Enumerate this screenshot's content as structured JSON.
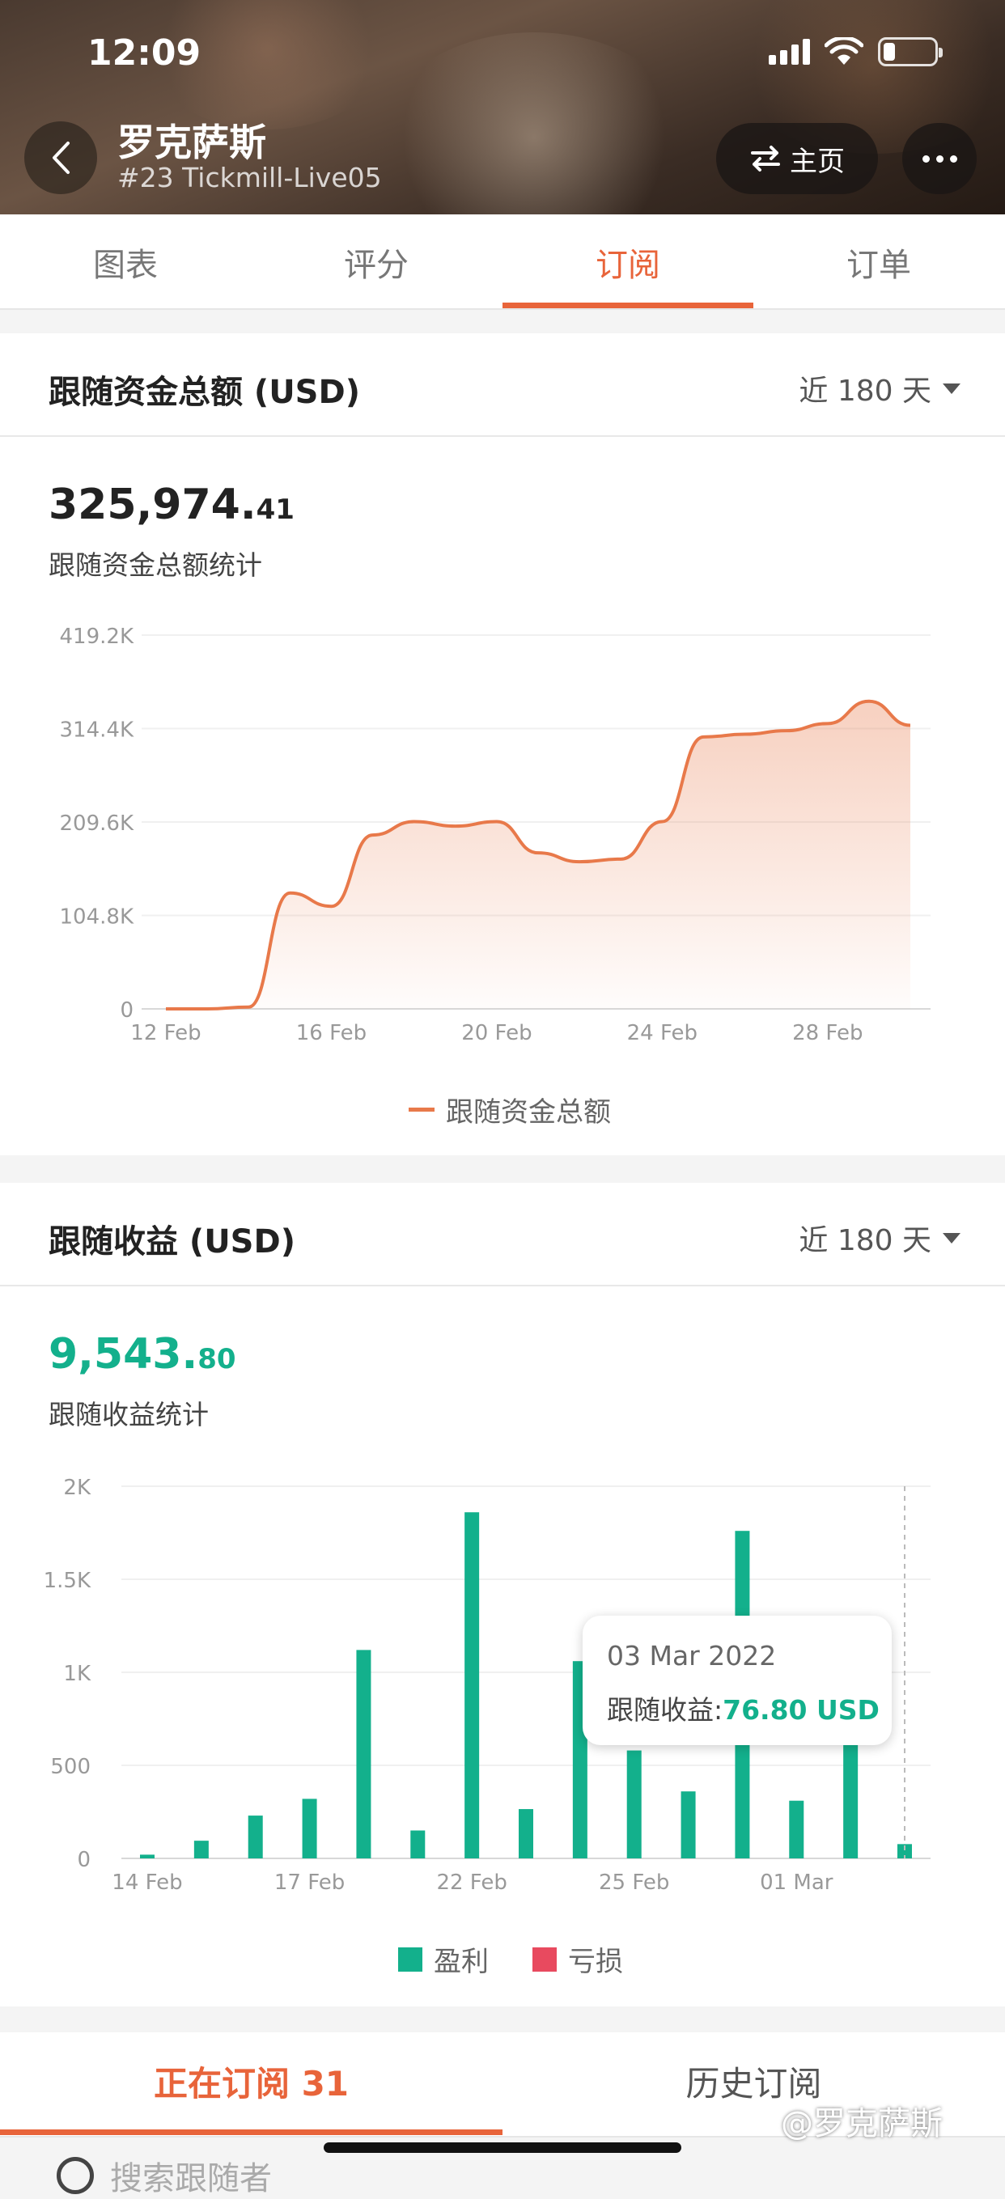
{
  "status": {
    "time": "12:09"
  },
  "header": {
    "title": "罗克萨斯",
    "subtitle": "#23 Tickmill-Live05",
    "home_label": "主页"
  },
  "tabs": [
    {
      "label": "图表",
      "active": false
    },
    {
      "label": "评分",
      "active": false
    },
    {
      "label": "订阅",
      "active": true
    },
    {
      "label": "订单",
      "active": false
    }
  ],
  "funds_card": {
    "title": "跟随资金总额 (USD)",
    "range": "近 180 天",
    "total_int": "325,974.",
    "total_dec": "41",
    "total_label": "跟随资金总额统计",
    "legend": "跟随资金总额"
  },
  "profit_card": {
    "title": "跟随收益 (USD)",
    "range": "近 180 天",
    "total_int": "9,543.",
    "total_dec": "80",
    "total_label": "跟随收益统计",
    "legend_profit": "盈利",
    "legend_loss": "亏损",
    "tooltip_date": "03 Mar 2022",
    "tooltip_label": "跟随收益:",
    "tooltip_value": "76.80 USD"
  },
  "colors": {
    "accent": "#e8643a",
    "profit": "#13b08c",
    "loss": "#e84a5f",
    "line": "#e8794a"
  },
  "chart_data": [
    {
      "type": "area",
      "series": [
        {
          "name": "跟随资金总额",
          "x": [
            "12 Feb",
            "13 Feb",
            "14 Feb",
            "15 Feb",
            "16 Feb",
            "17 Feb",
            "18 Feb",
            "19 Feb",
            "20 Feb",
            "21 Feb",
            "22 Feb",
            "23 Feb",
            "24 Feb",
            "25 Feb",
            "26 Feb",
            "27 Feb",
            "28 Feb",
            "01 Mar",
            "02 Mar"
          ],
          "values": [
            0,
            0,
            2000,
            130000,
            115000,
            195000,
            210000,
            205000,
            210000,
            175000,
            165000,
            168000,
            210000,
            305000,
            308000,
            312000,
            320000,
            345000,
            318000
          ]
        }
      ],
      "x_ticks": [
        "12 Feb",
        "16 Feb",
        "20 Feb",
        "24 Feb",
        "28 Feb"
      ],
      "y_ticks": [
        "0",
        "104.8K",
        "209.6K",
        "314.4K",
        "419.2K"
      ],
      "ylim": [
        0,
        419200
      ],
      "legend": "bottom-center"
    },
    {
      "type": "bar",
      "categories": [
        "14 Feb",
        "15 Feb",
        "16 Feb",
        "17 Feb",
        "18 Feb",
        "19 Feb",
        "21 Feb",
        "22 Feb",
        "23 Feb",
        "24 Feb",
        "25 Feb",
        "26 Feb",
        "27 Feb",
        "28 Feb",
        "01 Mar",
        "02 Mar",
        "03 Mar"
      ],
      "series": [
        {
          "name": "盈利",
          "values": [
            20,
            95,
            230,
            320,
            1120,
            150,
            1860,
            265,
            1060,
            580,
            360,
            1760,
            310,
            620,
            76.8
          ]
        }
      ],
      "x_ticks": [
        "14 Feb",
        "17 Feb",
        "22 Feb",
        "25 Feb",
        "01 Mar"
      ],
      "y_ticks": [
        "0",
        "500",
        "1K",
        "1.5K",
        "2K"
      ],
      "ylim": [
        0,
        2000
      ],
      "legend": "bottom-center"
    }
  ],
  "bottom_tabs": [
    {
      "label": "正在订阅 31",
      "active": true
    },
    {
      "label": "历史订阅",
      "active": false
    }
  ],
  "search_placeholder": "搜索跟随者",
  "watermark": "@罗克萨斯"
}
